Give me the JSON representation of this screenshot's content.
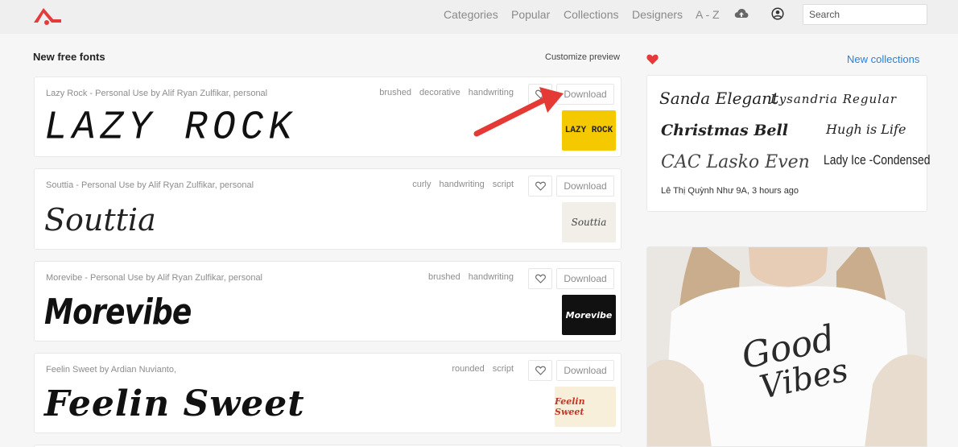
{
  "nav": {
    "items": [
      "Categories",
      "Popular",
      "Collections",
      "Designers",
      "A - Z"
    ],
    "search_placeholder": "Search",
    "icons": [
      "logo-icon",
      "cloud-upload-icon",
      "user-icon"
    ]
  },
  "main": {
    "section_title": "New free fonts",
    "customize_label": "Customize preview",
    "fonts": [
      {
        "meta": "Lazy Rock - Personal Use by Alif Ryan Zulfikar, personal",
        "tags": [
          "brushed",
          "decorative",
          "handwriting"
        ],
        "download_label": "Download",
        "preview": "LAZY ROCK",
        "thumb_text": "LAZY ROCK"
      },
      {
        "meta": "Souttia - Personal Use by Alif Ryan Zulfikar, personal",
        "tags": [
          "curly",
          "handwriting",
          "script"
        ],
        "download_label": "Download",
        "preview": "Souttia",
        "thumb_text": "Souttia"
      },
      {
        "meta": "Morevibe - Personal Use by Alif Ryan Zulfikar, personal",
        "tags": [
          "brushed",
          "handwriting"
        ],
        "download_label": "Download",
        "preview": "Morevibe",
        "thumb_text": "Morevibe"
      },
      {
        "meta": "Feelin Sweet by Ardian Nuvianto,",
        "tags": [
          "rounded",
          "script"
        ],
        "download_label": "Download",
        "preview": "Feelin Sweet",
        "thumb_text": "Feelin Sweet"
      }
    ]
  },
  "sidebar": {
    "new_collections_label": "New collections",
    "collection": {
      "words": [
        "Sanda Elegant",
        "Lysandria Regular",
        "Christmas Bell",
        "Hugh is Life",
        "CAC Lasko Even",
        "Lady Ice -Condensed"
      ],
      "author": "Lê Thị Quỳnh Như 9A, 3 hours ago"
    },
    "shirt_text": [
      "Good",
      "Vibes"
    ]
  },
  "colors": {
    "accent_red": "#e8393a",
    "link_blue": "#2d7fd6",
    "arrow_red": "#e53935"
  }
}
